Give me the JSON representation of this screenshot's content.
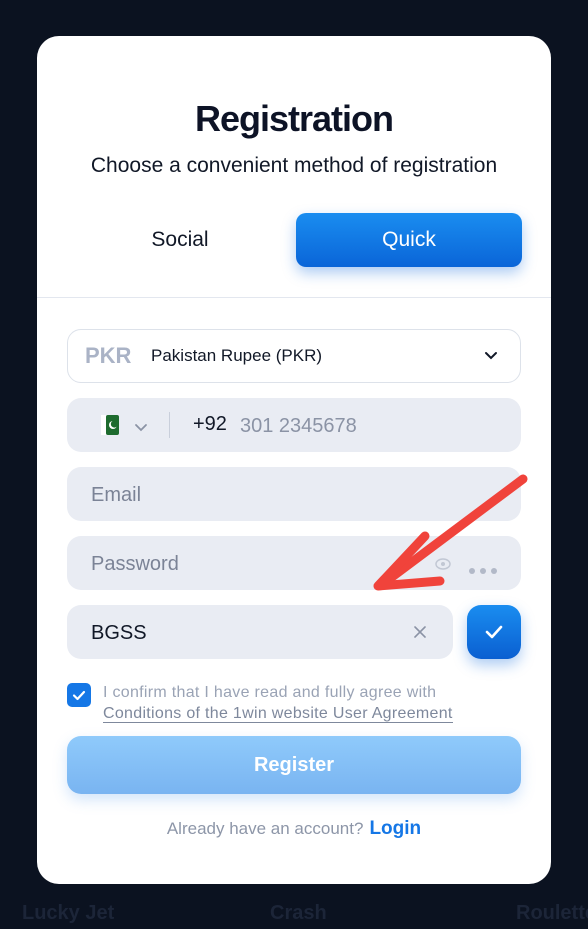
{
  "background": {
    "labels": [
      "Lucky Jet",
      "Crash",
      "Roulette"
    ]
  },
  "modal": {
    "title": "Registration",
    "subtitle": "Choose a convenient method of registration",
    "tabs": [
      {
        "label": "Social",
        "active": false
      },
      {
        "label": "Quick",
        "active": true
      }
    ],
    "currency": {
      "code": "PKR",
      "name": "Pakistan Rupee (PKR)",
      "icon": "chevron-down-icon"
    },
    "phone": {
      "country_flag": "pakistan-flag-icon",
      "dial_code": "+92",
      "placeholder": "301 2345678",
      "value": ""
    },
    "email": {
      "placeholder": "Email",
      "value": ""
    },
    "password": {
      "placeholder": "Password",
      "value": ""
    },
    "promo": {
      "value": "BGSS"
    },
    "agreement": {
      "checked": true,
      "text": "I confirm that I have read and fully agree with",
      "link": "Conditions of the 1win website User Agreement"
    },
    "register_label": "Register",
    "footer": {
      "question": "Already have an account?",
      "login_label": "Login"
    }
  },
  "colors": {
    "accent": "#1577e6",
    "annotation_arrow": "#f0433b"
  }
}
